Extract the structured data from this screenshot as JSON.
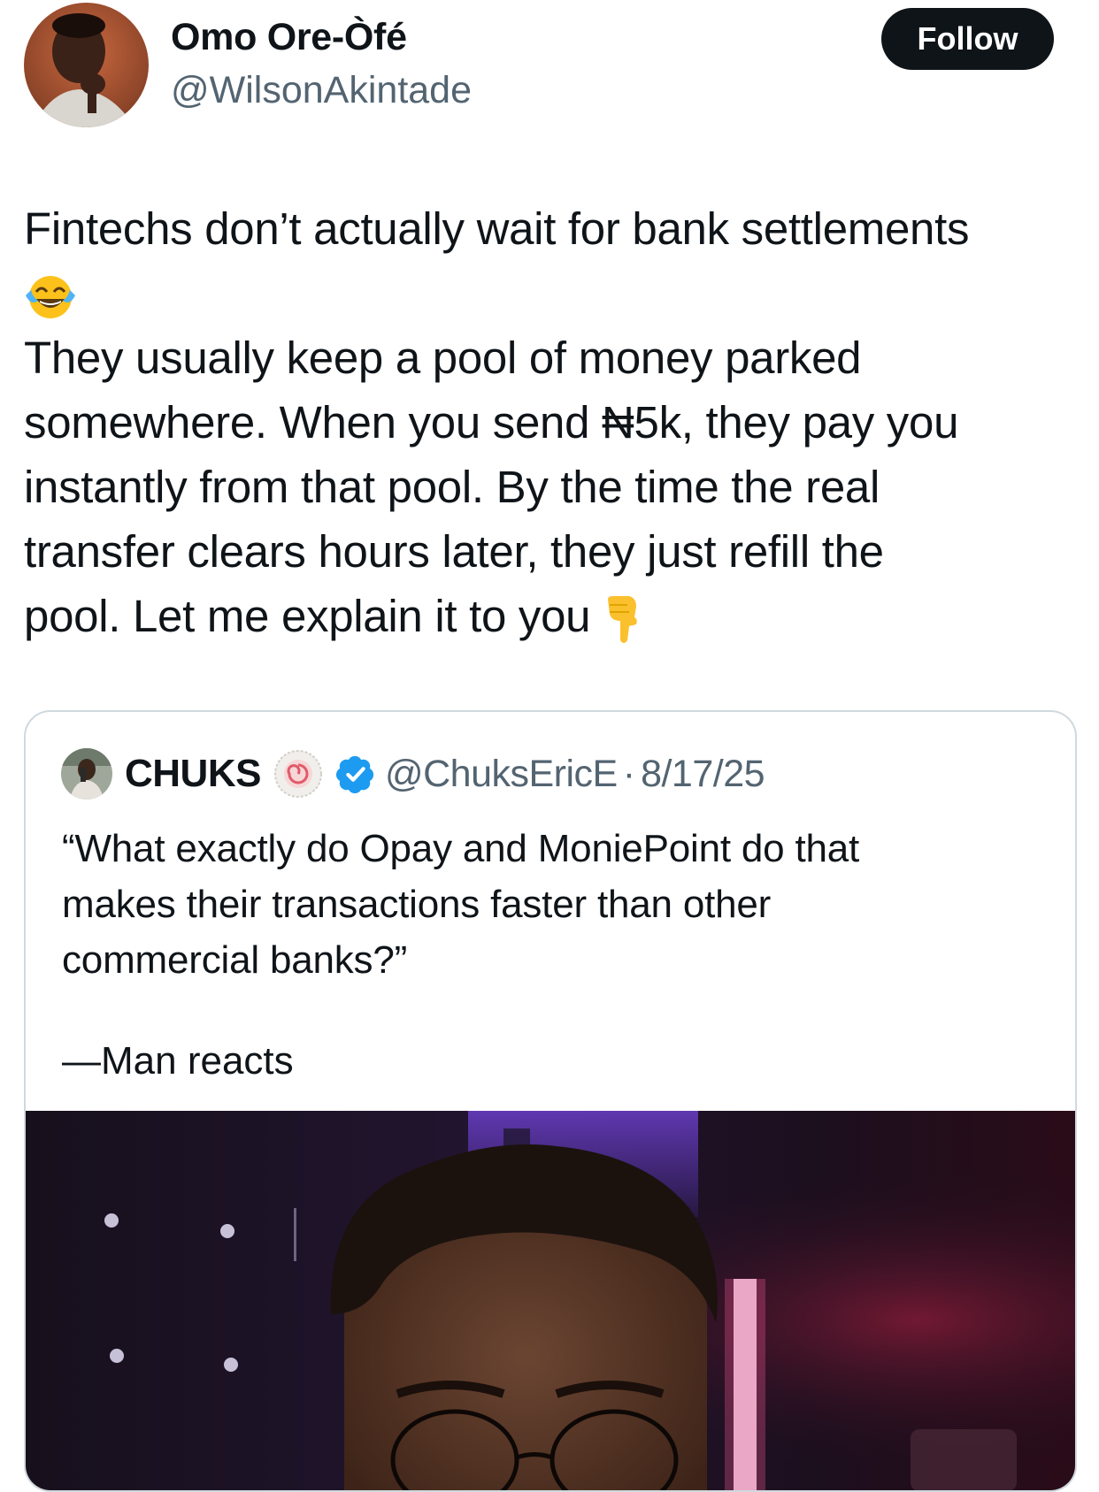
{
  "author": {
    "name": "Omo Ore-Òfé",
    "handle": "@WilsonAkintade",
    "avatar_icon": "user-avatar-photo"
  },
  "follow_button": {
    "label": "Follow"
  },
  "tweet": {
    "lines": [
      "Fintechs don’t actually wait for bank settlements",
      "They usually keep a pool of money parked",
      "somewhere. When you send ₦5k, they pay you",
      "instantly from that pool. By the time the real",
      "transfer clears hours later, they just refill the",
      "pool. Let me explain it to you"
    ],
    "emojis": [
      "tears-of-joy-emoji",
      "pointing-down-emoji"
    ]
  },
  "quote": {
    "author_name": "CHUKS",
    "handle": "@ChuksEricE",
    "separator": "·",
    "date": "8/17/25",
    "lines": [
      "“What exactly do Opay and MoniePoint do that",
      "makes their transactions faster than other",
      "commercial banks?”"
    ],
    "attribution": "—Man reacts",
    "badges": [
      "affiliate-badge",
      "verified-badge"
    ],
    "media": "video-thumbnail-man-with-glasses"
  },
  "colors": {
    "text": "#0f1419",
    "secondary": "#536471",
    "border": "#cfd9de",
    "verified": "#1d9bf0",
    "follow_bg": "#0f1419"
  }
}
